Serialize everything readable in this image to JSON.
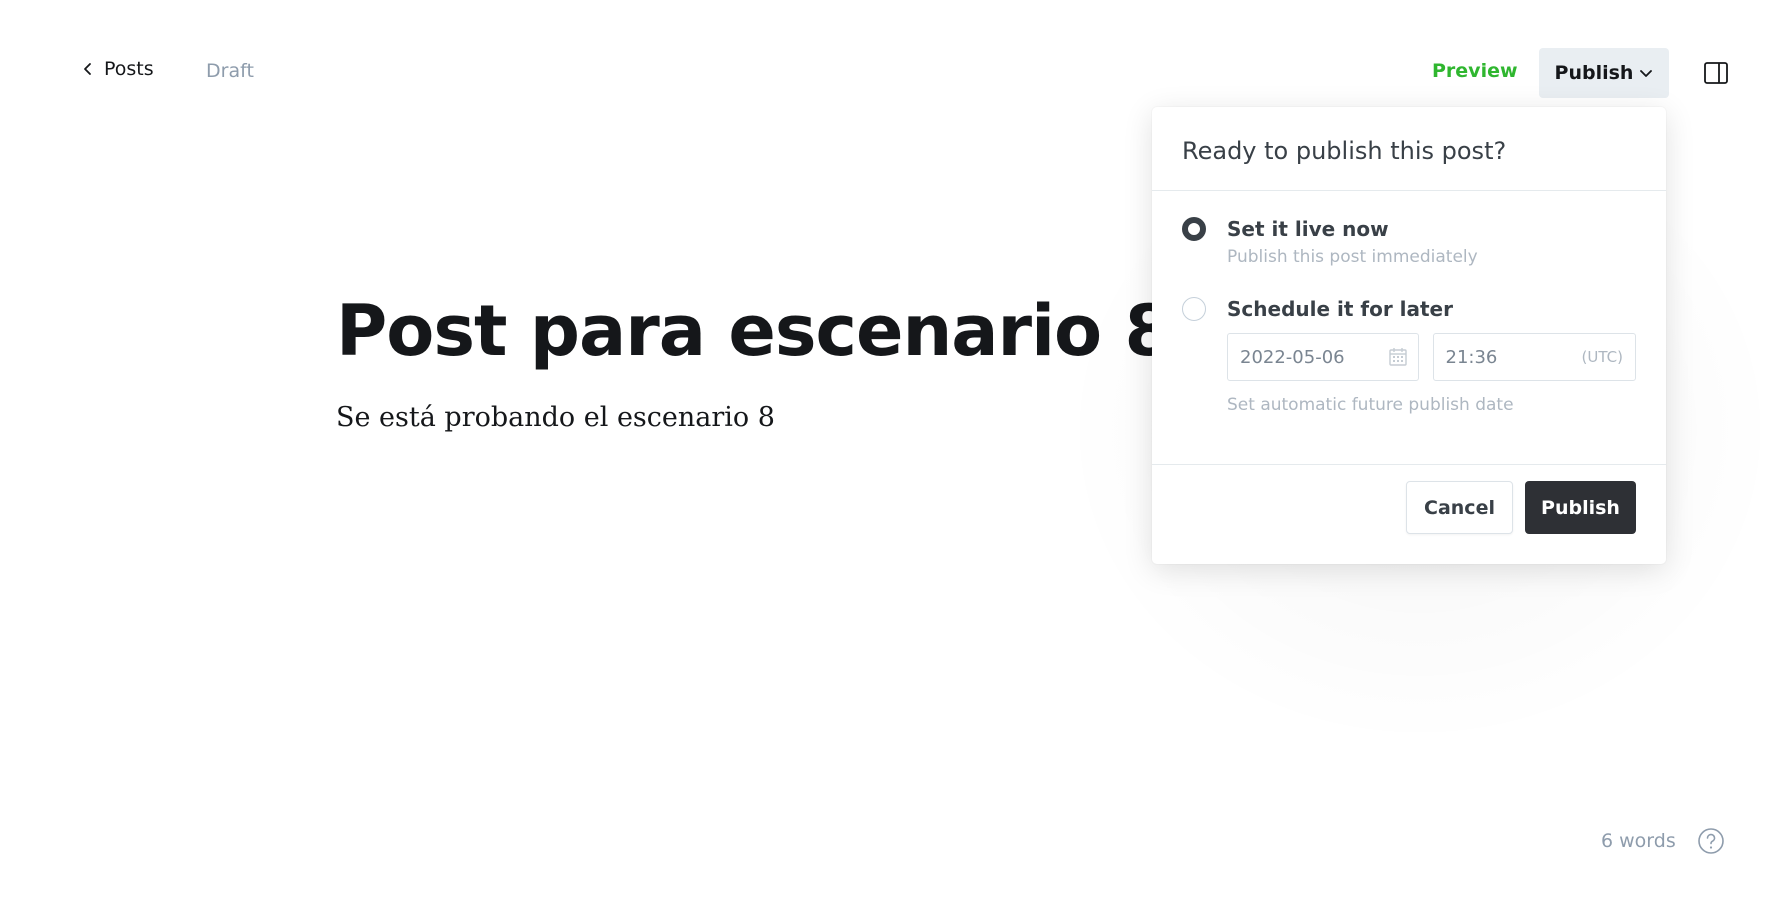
{
  "header": {
    "back_label": "Posts",
    "status": "Draft",
    "preview_label": "Preview",
    "publish_toggle_label": "Publish",
    "icons": {
      "back": "chevron-left-icon",
      "publish_dropdown": "chevron-down-icon",
      "sidebar": "sidebar-panel-icon"
    }
  },
  "editor": {
    "title": "Post para escenario 8",
    "body": "Se está probando el escenario 8"
  },
  "publish_menu": {
    "heading": "Ready to publish this post?",
    "options": [
      {
        "label": "Set it live now",
        "description": "Publish this post immediately",
        "selected": true
      },
      {
        "label": "Schedule it for later",
        "description": "Set automatic future publish date",
        "selected": false
      }
    ],
    "schedule": {
      "date": "2022-05-06",
      "time": "21:36",
      "timezone": "(UTC)",
      "date_icon": "calendar-icon"
    },
    "cancel_label": "Cancel",
    "publish_label": "Publish"
  },
  "footer": {
    "word_count": "6 words",
    "help_icon": "help-circle-icon"
  },
  "colors": {
    "accent_green": "#2fb62f",
    "dark_button": "#2e3035",
    "toggle_bg": "#e9eef2",
    "muted_text": "#8e9cac"
  }
}
